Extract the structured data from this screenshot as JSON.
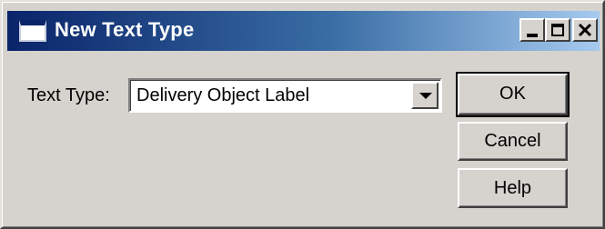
{
  "window": {
    "title": "New Text Type",
    "icon": "window-icon",
    "controls": [
      "minimize-icon",
      "maximize-icon",
      "close-icon"
    ]
  },
  "form": {
    "text_type_label": "Text Type:",
    "text_type_value": "Delivery Object Label"
  },
  "buttons": {
    "ok": "OK",
    "cancel": "Cancel",
    "help": "Help"
  },
  "colors": {
    "titlebar_start": "#0a246a",
    "titlebar_end": "#a6caf0",
    "face": "#d6d3ce"
  }
}
